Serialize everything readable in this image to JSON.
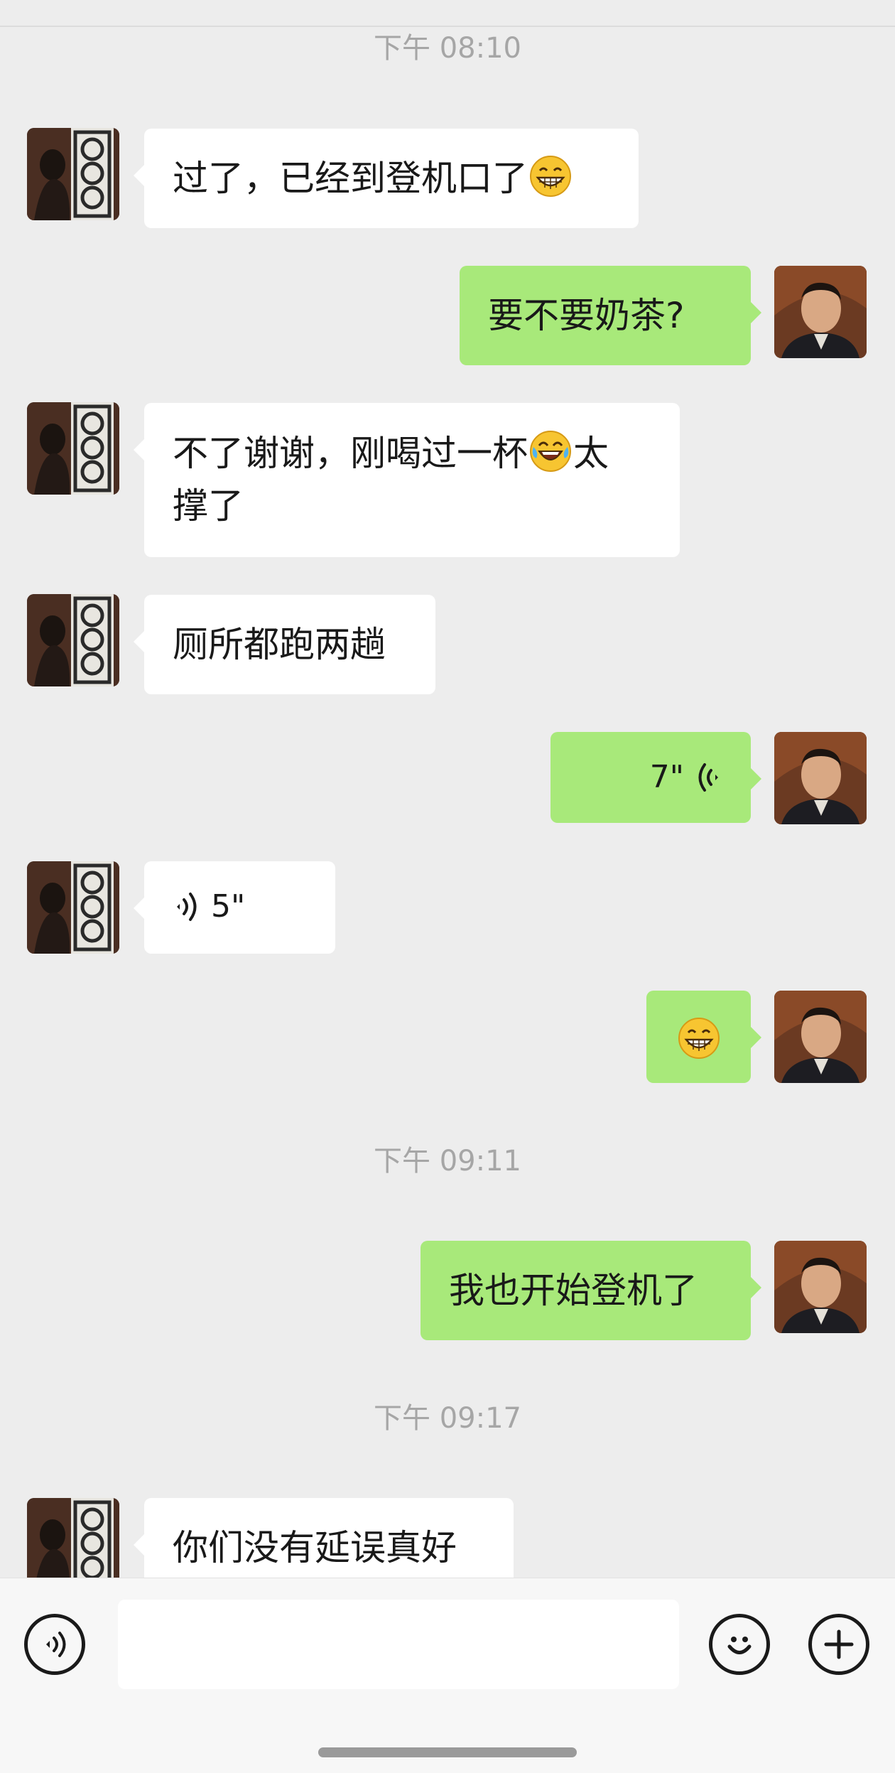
{
  "chat": {
    "timestamps": [
      "下午 08:10",
      "下午 09:11",
      "下午 09:17"
    ],
    "messages": [
      {
        "from": "them",
        "text": "过了，已经到登机口了",
        "emoji": "grin-emoji"
      },
      {
        "from": "me",
        "text": "要不要奶茶?"
      },
      {
        "from": "them",
        "line1": "不了谢谢，刚喝过一杯",
        "emoji": "laugh-cry-emoji",
        "line1_tail": "太",
        "line2": "撑了"
      },
      {
        "from": "them",
        "text": "厕所都跑两趟"
      },
      {
        "from": "me",
        "type": "voice",
        "duration": "7\""
      },
      {
        "from": "them",
        "type": "voice",
        "duration": "5\""
      },
      {
        "from": "me",
        "emoji": "grin-emoji"
      },
      {
        "from": "me",
        "text": "我也开始登机了"
      },
      {
        "from": "them",
        "text": "你们没有延误真好"
      }
    ]
  },
  "input_bar": {
    "voice_icon": "voice-input-icon",
    "emoji_icon": "emoji-icon",
    "add_icon": "plus-icon"
  },
  "colors": {
    "background": "#ededed",
    "incoming_bubble": "#ffffff",
    "outgoing_bubble": "#a8e97a",
    "timestamp": "#a6a6a6"
  }
}
